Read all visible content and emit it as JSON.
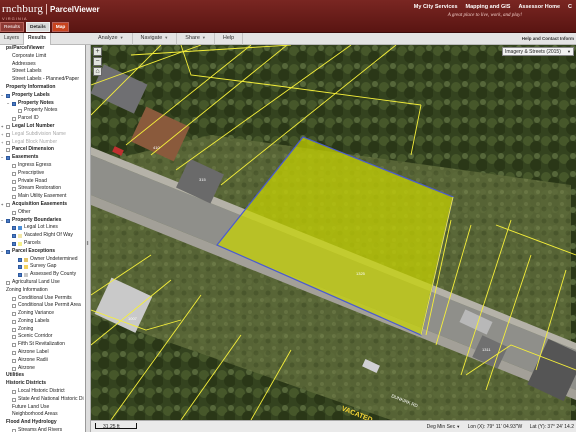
{
  "header": {
    "city": "rnchburg",
    "separator": "|",
    "app_name": "ParcelViewer",
    "state": "VIRGINIA",
    "tagline": "A great place to live, work, and play!",
    "links": [
      "My City Services",
      "Mapping and GIS",
      "Assessor Home",
      "C"
    ],
    "tabs": [
      {
        "label": "Results",
        "state": "normal"
      },
      {
        "label": "Details",
        "state": "active"
      },
      {
        "label": "Map",
        "state": "map"
      }
    ]
  },
  "panel_tabs": [
    "Layers",
    "Results"
  ],
  "menu": [
    {
      "label": "Analyze",
      "caret": true
    },
    {
      "label": "Navigate",
      "caret": true
    },
    {
      "label": "Share",
      "caret": true
    },
    {
      "label": "Help",
      "caret": false
    }
  ],
  "help_contact": "Help and Contact Inform",
  "basemap": {
    "selected": "Imagery & Streets (2015)"
  },
  "zoom_tools": [
    "+",
    "−",
    "⌂"
  ],
  "layers": [
    {
      "label": "ps/ParcelViewer",
      "level": 0,
      "check": null,
      "expander": "",
      "style": "header",
      "swatch": null
    },
    {
      "label": "Corporate Limit",
      "level": 1,
      "check": null,
      "expander": "",
      "style": "",
      "swatch": null
    },
    {
      "label": "Addresses",
      "level": 1,
      "check": null,
      "expander": "",
      "style": "",
      "swatch": null
    },
    {
      "label": "Street Labels",
      "level": 1,
      "check": null,
      "expander": "",
      "style": "",
      "swatch": null
    },
    {
      "label": "Street Labels - Planned/Paper",
      "level": 1,
      "check": null,
      "expander": "",
      "style": "",
      "swatch": null
    },
    {
      "label": "Property Information",
      "level": 0,
      "check": null,
      "expander": "",
      "style": "header",
      "swatch": null
    },
    {
      "label": "Property Labels",
      "level": 0,
      "check": true,
      "expander": "−",
      "style": "header",
      "swatch": null
    },
    {
      "label": "Property Notes",
      "level": 1,
      "check": true,
      "expander": "−",
      "style": "header",
      "swatch": null
    },
    {
      "label": "Property Notes",
      "level": 2,
      "check": false,
      "expander": "",
      "style": "",
      "swatch": null
    },
    {
      "label": "Parcel ID",
      "level": 1,
      "check": false,
      "expander": "",
      "style": "",
      "swatch": null
    },
    {
      "label": "Legal Lot Number",
      "level": 0,
      "check": false,
      "expander": "+",
      "style": "header",
      "swatch": null
    },
    {
      "label": "Legal Subdivision Name",
      "level": 0,
      "check": false,
      "expander": "+",
      "style": "grey",
      "swatch": null
    },
    {
      "label": "Legal Block Number",
      "level": 0,
      "check": false,
      "expander": "+",
      "style": "grey",
      "swatch": null
    },
    {
      "label": "Parcel Dimension",
      "level": 0,
      "check": false,
      "expander": "",
      "style": "header",
      "swatch": null
    },
    {
      "label": "Easements",
      "level": 0,
      "check": true,
      "expander": "−",
      "style": "header",
      "swatch": null
    },
    {
      "label": "Ingress Egress",
      "level": 1,
      "check": false,
      "expander": "",
      "style": "",
      "swatch": null
    },
    {
      "label": "Prescriptive",
      "level": 1,
      "check": false,
      "expander": "",
      "style": "",
      "swatch": null
    },
    {
      "label": "Private Road",
      "level": 1,
      "check": false,
      "expander": "",
      "style": "",
      "swatch": null
    },
    {
      "label": "Stream Restoration",
      "level": 1,
      "check": false,
      "expander": "",
      "style": "",
      "swatch": null
    },
    {
      "label": "Main Utility Easement",
      "level": 1,
      "check": false,
      "expander": "",
      "style": "",
      "swatch": null
    },
    {
      "label": "Acquisition Easements",
      "level": 0,
      "check": false,
      "expander": "+",
      "style": "header",
      "swatch": null
    },
    {
      "label": "Other",
      "level": 1,
      "check": false,
      "expander": "",
      "style": "",
      "swatch": null
    },
    {
      "label": "Property Boundaries",
      "level": 0,
      "check": true,
      "expander": "−",
      "style": "header",
      "swatch": null
    },
    {
      "label": "Legal Lot Lines",
      "level": 1,
      "check": true,
      "expander": "",
      "style": "",
      "swatch": "#4a8fd8"
    },
    {
      "label": "Vacated Right Of Way",
      "level": 1,
      "check": true,
      "expander": "",
      "style": "",
      "swatch": "#f2e6a6"
    },
    {
      "label": "Parcels",
      "level": 1,
      "check": true,
      "expander": "",
      "style": "",
      "swatch": "#f5f08a"
    },
    {
      "label": "Parcel Exceptions",
      "level": 0,
      "check": true,
      "expander": "−",
      "style": "header",
      "swatch": null
    },
    {
      "label": "Owner Undetermined",
      "level": 2,
      "check": true,
      "expander": "",
      "style": "",
      "swatch": "#e5c66a"
    },
    {
      "label": "Survey Gap",
      "level": 2,
      "check": true,
      "expander": "",
      "style": "",
      "swatch": "#f5d35e"
    },
    {
      "label": "Assessed By County",
      "level": 2,
      "check": true,
      "expander": "",
      "style": "",
      "swatch": "#c8c8c8"
    },
    {
      "label": "Agricultural Land Use",
      "level": 0,
      "check": false,
      "expander": "",
      "style": "",
      "swatch": null
    },
    {
      "label": "Zoning Information",
      "level": 0,
      "check": null,
      "expander": "",
      "style": "",
      "swatch": null
    },
    {
      "label": "Conditional Use Permits",
      "level": 1,
      "check": false,
      "expander": "",
      "style": "",
      "swatch": null
    },
    {
      "label": "Conditional Use Permit Area",
      "level": 1,
      "check": false,
      "expander": "",
      "style": "",
      "swatch": null
    },
    {
      "label": "Zoning Variance",
      "level": 1,
      "check": false,
      "expander": "",
      "style": "",
      "swatch": null
    },
    {
      "label": "Zoning Labels",
      "level": 1,
      "check": false,
      "expander": "",
      "style": "",
      "swatch": null
    },
    {
      "label": "Zoning",
      "level": 1,
      "check": false,
      "expander": "",
      "style": "",
      "swatch": null
    },
    {
      "label": "Scenic Corridor",
      "level": 1,
      "check": false,
      "expander": "",
      "style": "",
      "swatch": null
    },
    {
      "label": "Fifth St Revitalization",
      "level": 1,
      "check": false,
      "expander": "",
      "style": "",
      "swatch": null
    },
    {
      "label": "Airzone Label",
      "level": 1,
      "check": false,
      "expander": "",
      "style": "",
      "swatch": null
    },
    {
      "label": "Airzone Radii",
      "level": 1,
      "check": false,
      "expander": "",
      "style": "",
      "swatch": null
    },
    {
      "label": "Airzone",
      "level": 1,
      "check": false,
      "expander": "",
      "style": "",
      "swatch": null
    },
    {
      "label": "Utilities",
      "level": 0,
      "check": null,
      "expander": "",
      "style": "header",
      "swatch": null
    },
    {
      "label": "Historic Districts",
      "level": 0,
      "check": null,
      "expander": "",
      "style": "header",
      "swatch": null
    },
    {
      "label": "Local Historic District",
      "level": 1,
      "check": false,
      "expander": "",
      "style": "",
      "swatch": null
    },
    {
      "label": "State And National Historic Di",
      "level": 1,
      "check": false,
      "expander": "",
      "style": "",
      "swatch": null
    },
    {
      "label": "Future Land Use",
      "level": 1,
      "check": null,
      "expander": "",
      "style": "",
      "swatch": null
    },
    {
      "label": "Neighborhood Areas",
      "level": 1,
      "check": null,
      "expander": "",
      "style": "",
      "swatch": null
    },
    {
      "label": "Flood And Hydrology",
      "level": 0,
      "check": null,
      "expander": "",
      "style": "header",
      "swatch": null
    },
    {
      "label": "Streams And Rivers",
      "level": 1,
      "check": false,
      "expander": "",
      "style": "",
      "swatch": null
    }
  ],
  "map": {
    "street_label": "VACATED",
    "parcel_labels": [
      "410",
      "315",
      "1325",
      "1311",
      "1007"
    ],
    "selected_parcel_color": "#c8d400",
    "road_label": "DUNKIRK RD"
  },
  "status": {
    "scale": "31.25 ft",
    "coord_mode": "Deg Min Sec",
    "lon": "Lon (X): 79° 11' 04.93\"W",
    "lat": "Lat (Y): 37° 24' 14.2"
  },
  "colors": {
    "header_bg": "#6b1c18",
    "toolbar_bg": "#e4e4e4",
    "parcel_line": "#f5ef3a",
    "selection_outline": "#4a5bd0"
  }
}
